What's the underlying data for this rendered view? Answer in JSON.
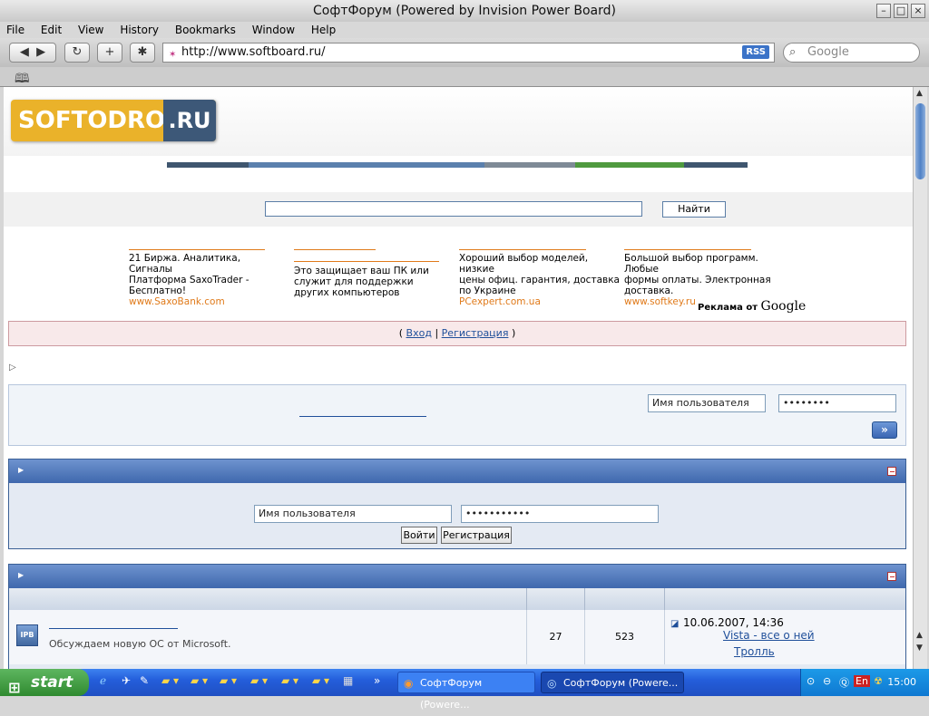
{
  "window": {
    "title": "СофтФорум (Powered by Invision Power Board)"
  },
  "menu": [
    "File",
    "Edit",
    "View",
    "History",
    "Bookmarks",
    "Window",
    "Help"
  ],
  "toolbar": {
    "url": "http://www.softboard.ru/",
    "rss": "RSS",
    "search_placeholder": "Google"
  },
  "logo": {
    "main": "SOFTODROM",
    "suffix": ".RU"
  },
  "search": {
    "button": "Найти"
  },
  "ads": [
    {
      "title": "21 Биржа. Аналитика, Сигналы",
      "text": "Платформа SaxoTrader - Бесплатно!",
      "url": "www.SaxoBank.com"
    },
    {
      "title": "",
      "text": "Это защищает ваш ПК или служит для поддержки других компьютеров",
      "url": ""
    },
    {
      "title": "Хороший выбор моделей, низкие",
      "text": "цены офиц. гарантия, доставка по Украине",
      "url": "PCexpert.com.ua"
    },
    {
      "title": "Большой выбор программ. Любые",
      "text": "формы оплаты. Электронная доставка.",
      "url": "www.softkey.ru"
    }
  ],
  "ads_by": {
    "prefix": "Реклама от",
    "brand": "Google"
  },
  "loginbar": {
    "open": "(",
    "login": "Вход",
    "sep": "|",
    "register": "Регистрация",
    "close": ")"
  },
  "box1": {
    "username": "Имя пользователя",
    "password": "••••••••",
    "go": "»"
  },
  "login_section": {
    "username": "Имя пользователя",
    "password": "•••••••••••",
    "login_button": "Войти",
    "register_button": "Регистрация"
  },
  "forum": {
    "row": {
      "icon": "IPB",
      "description": "Обсуждаем новую ОС от Microsoft.",
      "topics": "27",
      "posts": "523",
      "last_date": "10.06.2007, 14:36",
      "last_topic": "Vista - все о ней",
      "last_author": "Тролль"
    }
  },
  "taskbar": {
    "start": "start",
    "tasks": [
      "СофтФорум (Powere...",
      "СофтФорум (Powere..."
    ],
    "clock": "15:00",
    "lang": "En"
  }
}
